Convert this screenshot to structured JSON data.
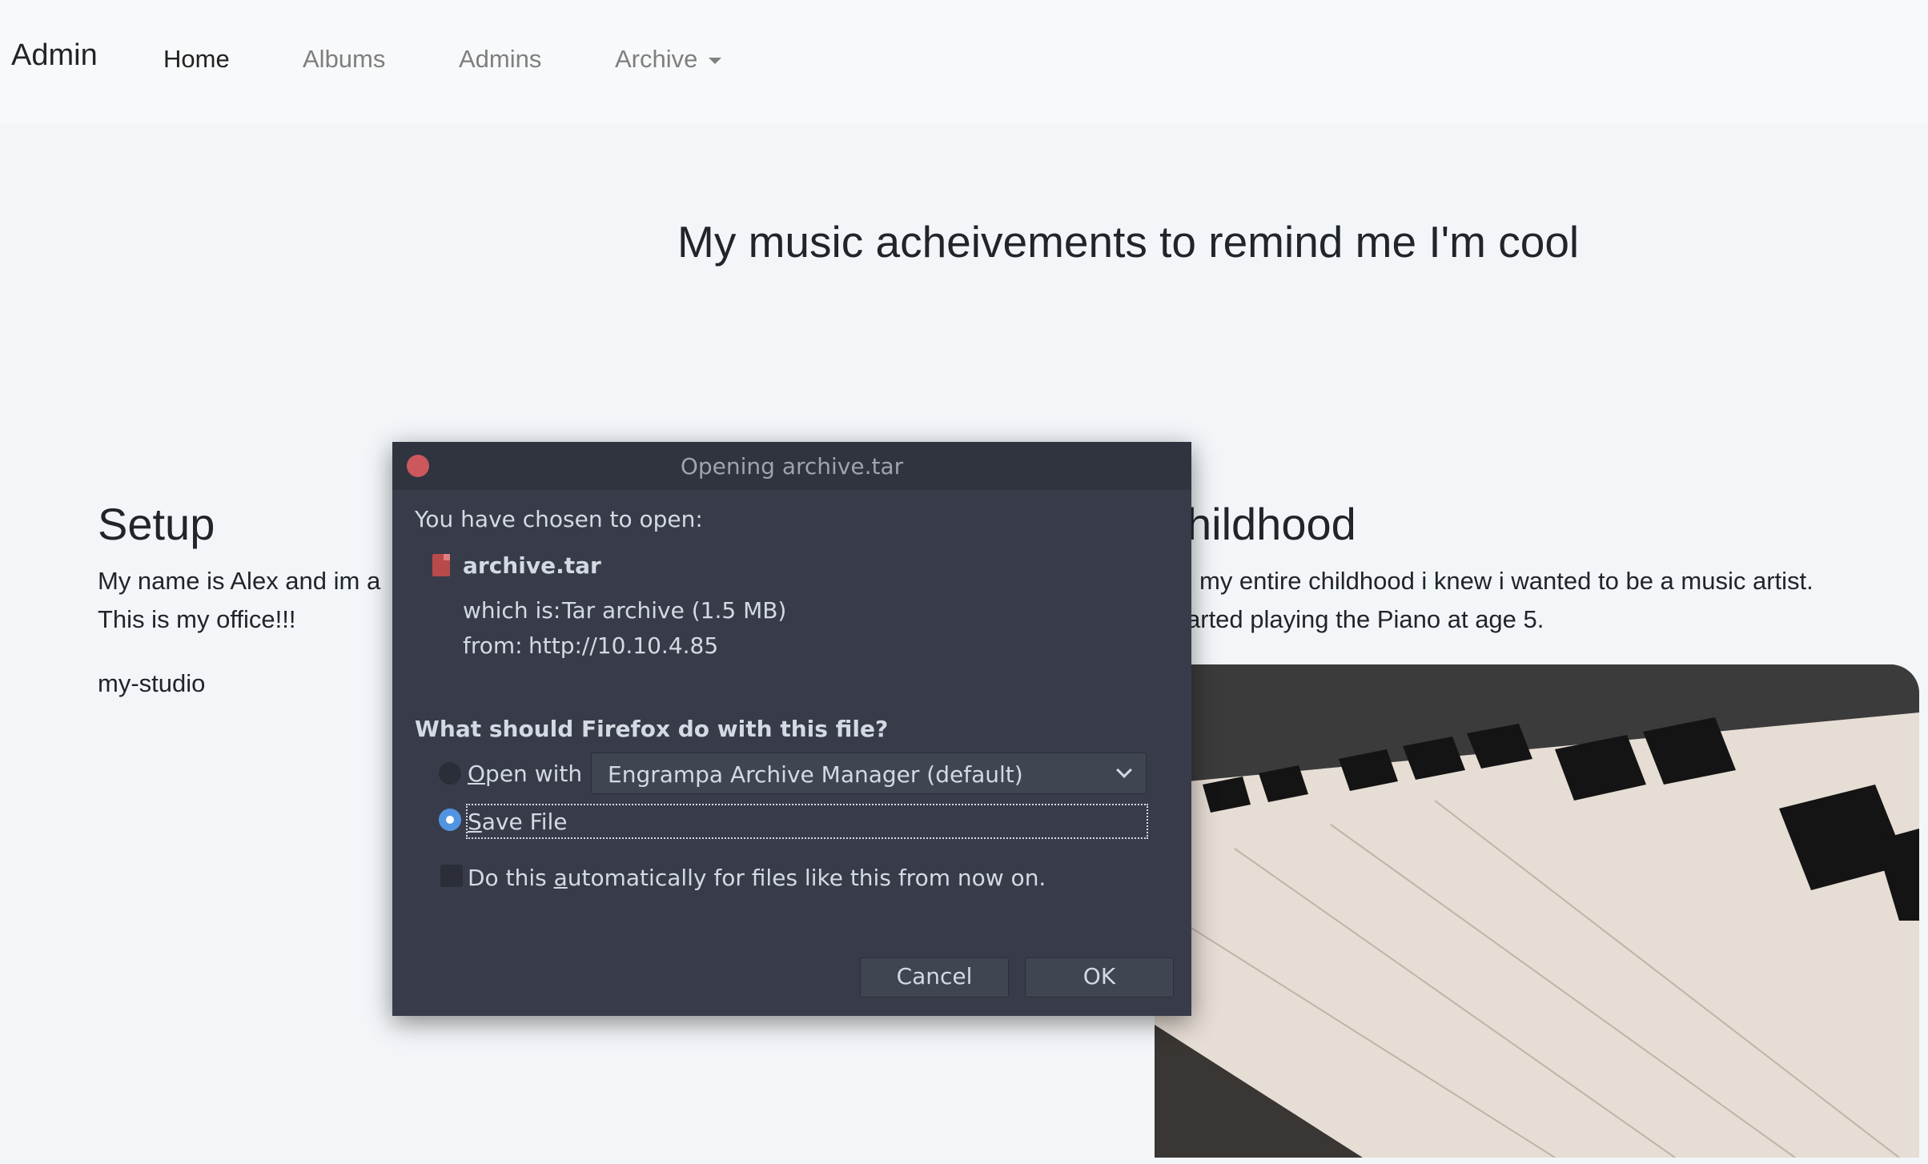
{
  "navbar": {
    "brand": "Admin",
    "links": [
      {
        "label": "Home"
      },
      {
        "label": "Albums"
      },
      {
        "label": "Admins"
      },
      {
        "label": "Archive"
      }
    ]
  },
  "hero": {
    "title": "My music acheivements to remind me I'm cool"
  },
  "setup": {
    "title": "Setup",
    "line1": "My name is Alex and im a",
    "line2": "This is my office!!!",
    "caption": "my-studio"
  },
  "childhood": {
    "title": "hildhood",
    "line1": "my entire childhood i knew i wanted to be a music artist.",
    "line2": "arted playing the Piano at age 5."
  },
  "dialog": {
    "title": "Opening archive.tar",
    "intro": "You have chosen to open:",
    "filename": "archive.tar",
    "which_is_label": "which is:",
    "which_is_value": "Tar archive (1.5 MB)",
    "from_label": "from:",
    "from_value": "http://10.10.4.85",
    "question": "What should Firefox do with this file?",
    "open_with_label": "Open with",
    "open_with_app": "Engrampa Archive Manager (default)",
    "save_file_label": "Save File",
    "auto_label": "Do this automatically for files like this from now on.",
    "cancel_label": "Cancel",
    "ok_label": "OK",
    "selected_option": "Save File",
    "auto_checked": false
  },
  "colors": {
    "dialog_bg": "#383c4a",
    "titlebar_bg": "#2f343f",
    "close_red": "#cc575d",
    "accent": "#5294e2"
  }
}
